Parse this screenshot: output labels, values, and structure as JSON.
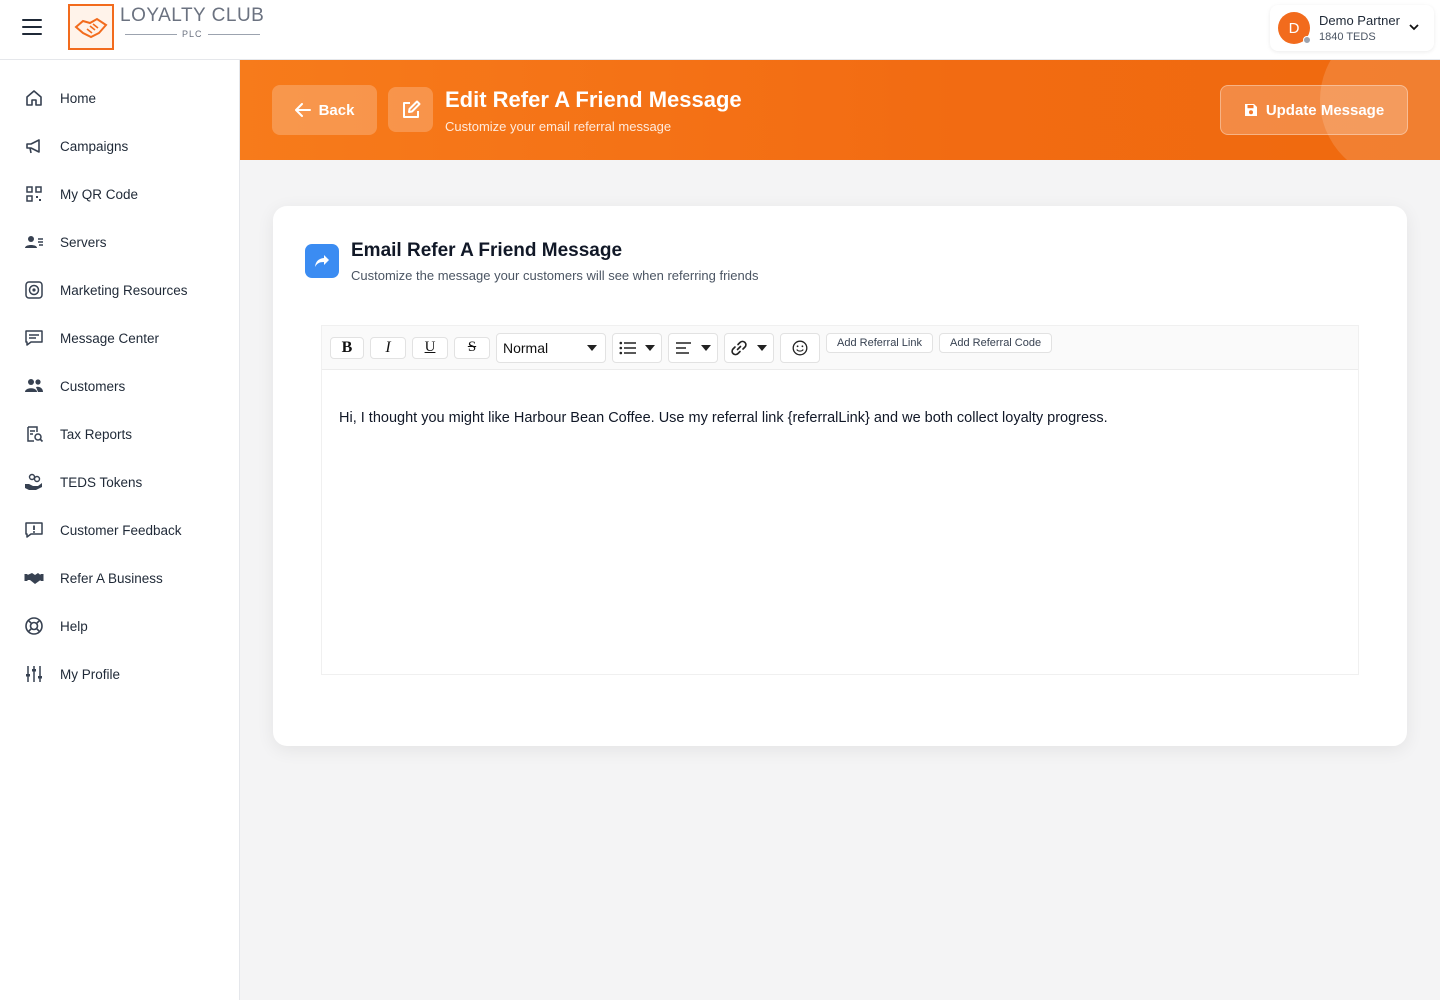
{
  "app": {
    "logo_title": "LOYALTY CLUB",
    "logo_sub": "PLC"
  },
  "account": {
    "initial": "D",
    "name": "Demo Partner",
    "teds": "1840 TEDS"
  },
  "sidebar": {
    "items": [
      {
        "label": "Home",
        "icon": "home-icon"
      },
      {
        "label": "Campaigns",
        "icon": "megaphone-icon"
      },
      {
        "label": "My QR Code",
        "icon": "qr-code-icon"
      },
      {
        "label": "Servers",
        "icon": "users-list-icon"
      },
      {
        "label": "Marketing Resources",
        "icon": "target-icon"
      },
      {
        "label": "Message Center",
        "icon": "message-icon"
      },
      {
        "label": "Customers",
        "icon": "customers-icon"
      },
      {
        "label": "Tax Reports",
        "icon": "tax-report-icon"
      },
      {
        "label": "TEDS Tokens",
        "icon": "tokens-icon"
      },
      {
        "label": "Customer Feedback",
        "icon": "feedback-icon"
      },
      {
        "label": "Refer A Business",
        "icon": "handshake-icon"
      },
      {
        "label": "Help",
        "icon": "lifebuoy-icon"
      },
      {
        "label": "My Profile",
        "icon": "sliders-icon"
      }
    ]
  },
  "header": {
    "back_label": "Back",
    "title": "Edit Refer A Friend Message",
    "subtitle": "Customize your email referral message",
    "update_label": "Update Message",
    "accent": "#f26b12"
  },
  "card": {
    "title": "Email Refer A Friend Message",
    "subtitle": "Customize the message your customers will see when referring friends",
    "icon_color": "#3b8cf2"
  },
  "editor": {
    "bold": "B",
    "italic": "I",
    "underline": "U",
    "strike": "S",
    "format_value": "Normal",
    "add_link_label": "Add Referral Link",
    "add_code_label": "Add Referral Code",
    "body": "Hi, I thought you might like Harbour Bean Coffee. Use my referral link {referralLink} and we both collect loyalty progress."
  }
}
